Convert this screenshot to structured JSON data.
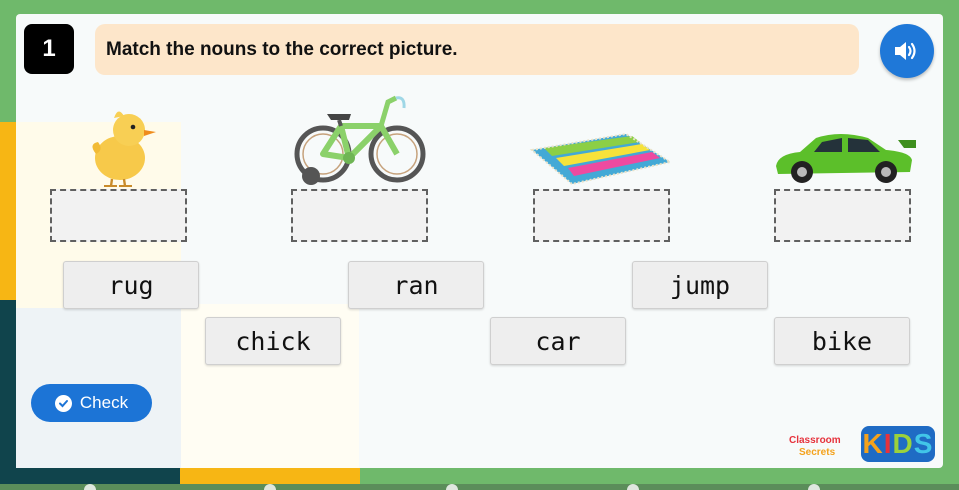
{
  "question": {
    "number": "1",
    "instruction": "Match the nouns to the correct picture."
  },
  "pictures": [
    {
      "name": "chick",
      "icon": "chick-picture"
    },
    {
      "name": "bike",
      "icon": "bike-picture"
    },
    {
      "name": "rug",
      "icon": "rug-picture"
    },
    {
      "name": "car",
      "icon": "car-picture"
    }
  ],
  "words": [
    "rug",
    "ran",
    "jump",
    "chick",
    "car",
    "bike"
  ],
  "check_button": {
    "label": "Check",
    "icon": "check-circle-icon"
  },
  "audio_button": {
    "icon": "speaker-icon"
  },
  "branding": {
    "classroom_line1": "Classroom",
    "classroom_line2": "Secrets",
    "kids": [
      "K",
      "I",
      "D",
      "S"
    ],
    "kids_colors": [
      "#f4a21c",
      "#e6323c",
      "#9bd13c",
      "#41c5e8"
    ]
  },
  "colors": {
    "background_green": "#6fb96b",
    "accent_blue": "#1c74d6",
    "instruction_bg": "#fde6ca"
  }
}
